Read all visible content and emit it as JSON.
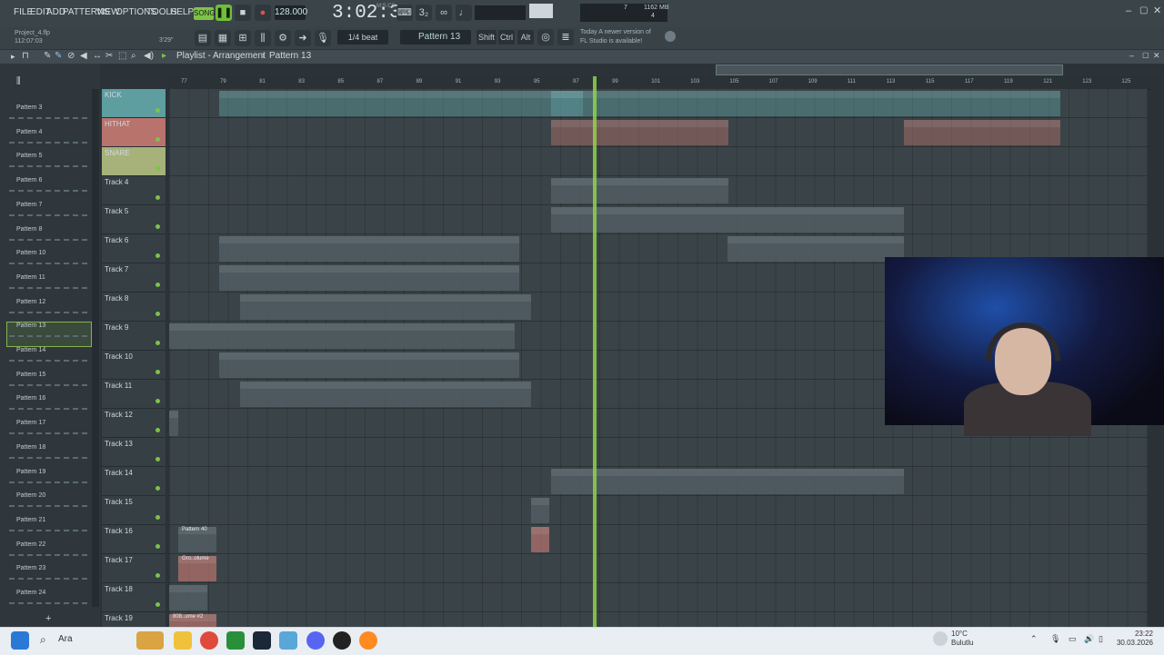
{
  "menu": [
    "FILE",
    "EDIT",
    "ADD",
    "PATTERNS",
    "VIEW",
    "OPTIONS",
    "TOOLS",
    "HELP"
  ],
  "transport": {
    "mode": "SONG",
    "tempo": "128.000",
    "time": "3:02:35",
    "time_unit": "M:S:CS"
  },
  "cpu": {
    "poly": "7",
    "mem": "1162 MB",
    "voices": "4"
  },
  "project": {
    "name": "Project_4.flp",
    "time": "112:07:03",
    "duration": "3'29\""
  },
  "snap": "1/4 beat",
  "pattern_selector": "Pattern 13",
  "keys": [
    "Shift",
    "Ctrl",
    "Alt"
  ],
  "news": {
    "line1": "Today  A newer version of",
    "line2": "FL Studio is available!"
  },
  "playlist": {
    "title": "Playlist - Arrangement",
    "crumb": "Pattern 13"
  },
  "patterns": [
    "Pattern 3",
    "Pattern 4",
    "Pattern 5",
    "Pattern 6",
    "Pattern 7",
    "Pattern 8",
    "Pattern 10",
    "Pattern 11",
    "Pattern 12",
    "Pattern 13",
    "Pattern 14",
    "Pattern 15",
    "Pattern 16",
    "Pattern 17",
    "Pattern 18",
    "Pattern 19",
    "Pattern 20",
    "Pattern 21",
    "Pattern 22",
    "Pattern 23",
    "Pattern 24"
  ],
  "ruler": [
    "77",
    "79",
    "81",
    "83",
    "85",
    "87",
    "89",
    "91",
    "93",
    "95",
    "97",
    "99",
    "101",
    "103",
    "105",
    "107",
    "109",
    "111",
    "113",
    "115",
    "117",
    "119",
    "121",
    "123",
    "125"
  ],
  "tracks": [
    {
      "name": "KICK",
      "color": "#5e9ea0"
    },
    {
      "name": "HITHAT",
      "color": "#b8736d"
    },
    {
      "name": "SNARE",
      "color": "#a6b27a"
    },
    {
      "name": "Track 4",
      "color": ""
    },
    {
      "name": "Track 5",
      "color": ""
    },
    {
      "name": "Track 6",
      "color": ""
    },
    {
      "name": "Track 7",
      "color": ""
    },
    {
      "name": "Track 8",
      "color": ""
    },
    {
      "name": "Track 9",
      "color": ""
    },
    {
      "name": "Track 10",
      "color": ""
    },
    {
      "name": "Track 11",
      "color": ""
    },
    {
      "name": "Track 12",
      "color": ""
    },
    {
      "name": "Track 13",
      "color": ""
    },
    {
      "name": "Track 14",
      "color": ""
    },
    {
      "name": "Track 15",
      "color": ""
    },
    {
      "name": "Track 16",
      "color": ""
    },
    {
      "name": "Track 17",
      "color": ""
    },
    {
      "name": "Track 18",
      "color": ""
    },
    {
      "name": "Track 19",
      "color": ""
    }
  ],
  "clip_labels": {
    "pattern40": "Pattern 40",
    "gross_volume": "Gro..olume",
    "vol808": "808..ume #2"
  },
  "taskbar": {
    "search": "Ara",
    "temp": "10°C",
    "weather": "Bulutlu",
    "time": "23:22",
    "date": "30.03.2026"
  }
}
